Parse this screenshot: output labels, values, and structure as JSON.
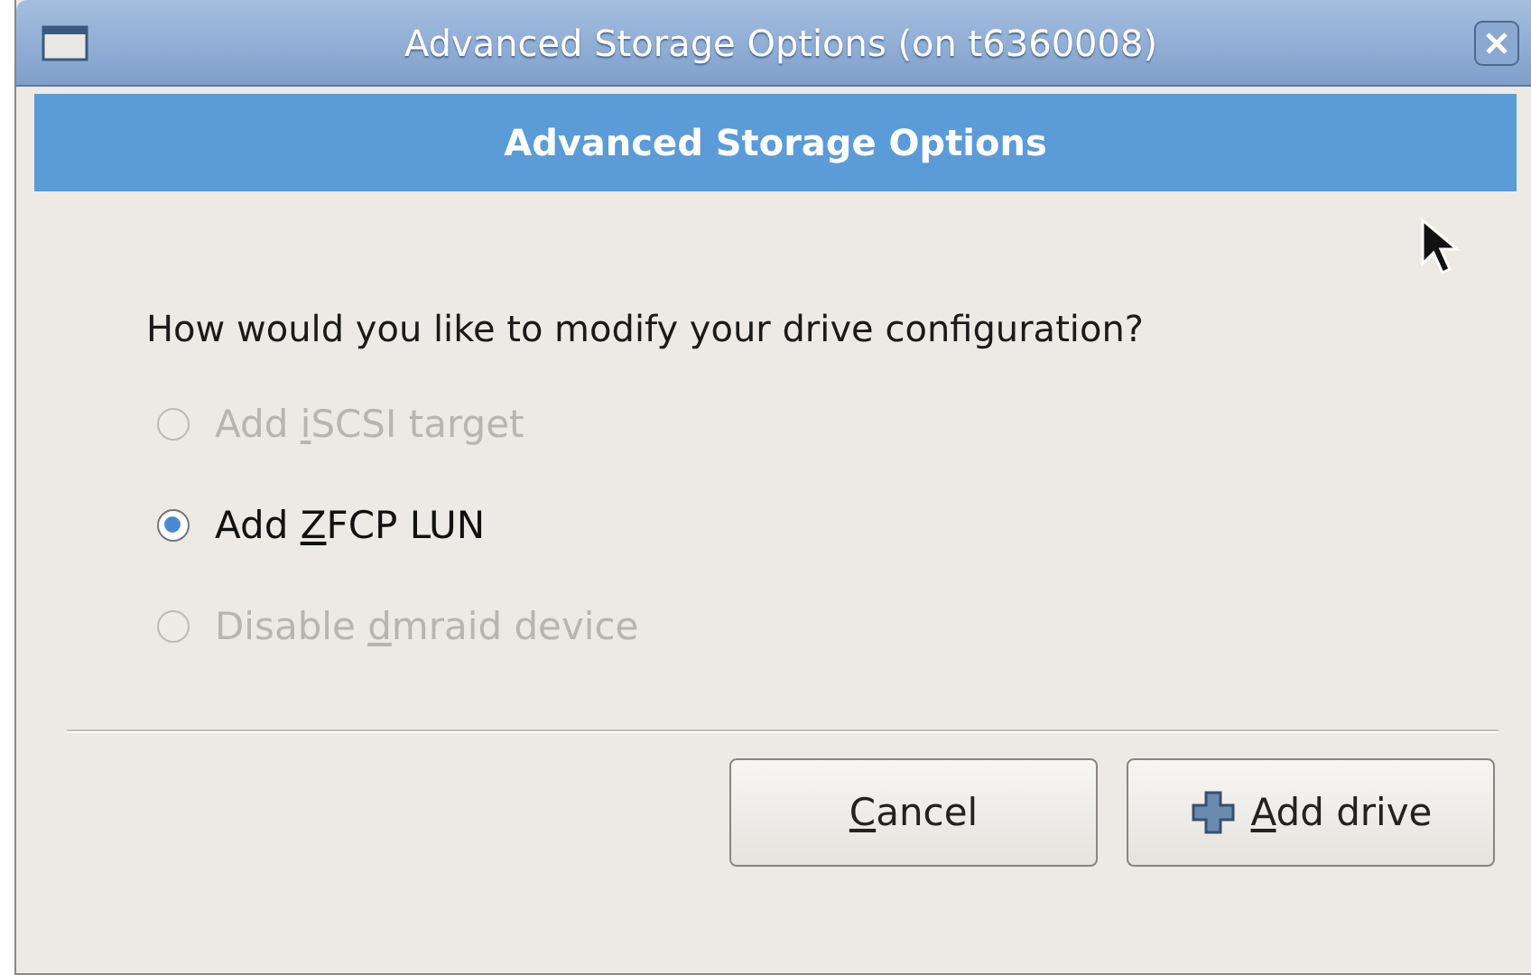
{
  "window": {
    "title": "Advanced Storage Options (on t6360008)"
  },
  "header": {
    "title": "Advanced Storage Options"
  },
  "question": "How would you like to modify your drive configuration?",
  "options": [
    {
      "label": {
        "pre": "Add ",
        "key": "i",
        "post": "SCSI target"
      },
      "selected": false,
      "disabled": true
    },
    {
      "label": {
        "pre": "Add ",
        "key": "Z",
        "post": "FCP LUN"
      },
      "selected": true,
      "disabled": false
    },
    {
      "label": {
        "pre": "Disable ",
        "key": "d",
        "post": "mraid device"
      },
      "selected": false,
      "disabled": true
    }
  ],
  "buttons": [
    {
      "kind": "plain",
      "label": {
        "key": "C",
        "post": "ancel"
      }
    },
    {
      "kind": "add",
      "label": {
        "key": "A",
        "post": "dd drive"
      }
    }
  ]
}
